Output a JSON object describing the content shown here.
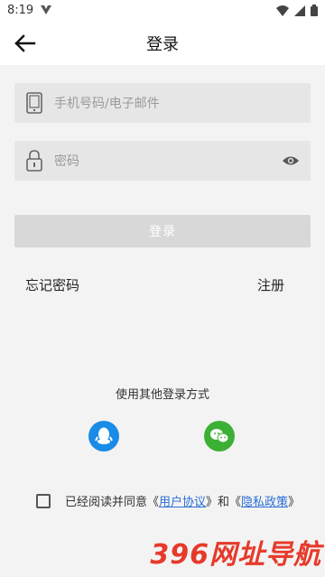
{
  "status_bar": {
    "time": "8:19"
  },
  "header": {
    "title": "登录"
  },
  "form": {
    "account_placeholder": "手机号码/电子邮件",
    "password_placeholder": "密码",
    "login_label": "登录"
  },
  "links": {
    "forgot": "忘记密码",
    "register": "注册"
  },
  "other_login": {
    "title": "使用其他登录方式"
  },
  "agreement": {
    "prefix": "已经阅读并同意《",
    "user_agreement": "用户协议",
    "middle": "》和《",
    "privacy_policy": "隐私政策",
    "suffix": "》"
  },
  "watermark": {
    "text": "396网址导航"
  },
  "colors": {
    "qq": "#1a8be6",
    "wechat": "#3cb034",
    "link": "#2b6fd6",
    "watermark": "#e63a2a"
  }
}
